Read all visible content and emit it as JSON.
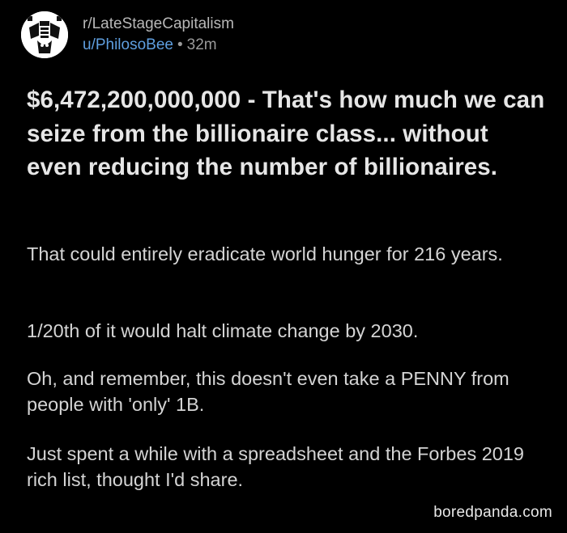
{
  "post": {
    "subreddit": "r/LateStageCapitalism",
    "author": "u/PhilosoBee",
    "separator": "•",
    "age": "32m",
    "avatar_icon": "philosobee-avatar-icon",
    "title": "$6,472,200,000,000 - That's how much we can seize from the billionaire class... without even reducing the number of billionaires.",
    "paragraphs": [
      "That could entirely eradicate world hunger for 216 years.",
      "1/20th of it would halt climate change by 2030.",
      "Oh, and remember, this doesn't even take a PENNY from people with 'only' 1B.",
      "Just spent a while with a spreadsheet and the Forbes 2019 rich list, thought I'd share."
    ]
  },
  "watermark": "boredpanda.com",
  "colors": {
    "background": "#000000",
    "title_text": "#e6e6e6",
    "body_text": "#d4d4d4",
    "username": "#5f9fe0",
    "meta_text": "#9a9a9a"
  }
}
